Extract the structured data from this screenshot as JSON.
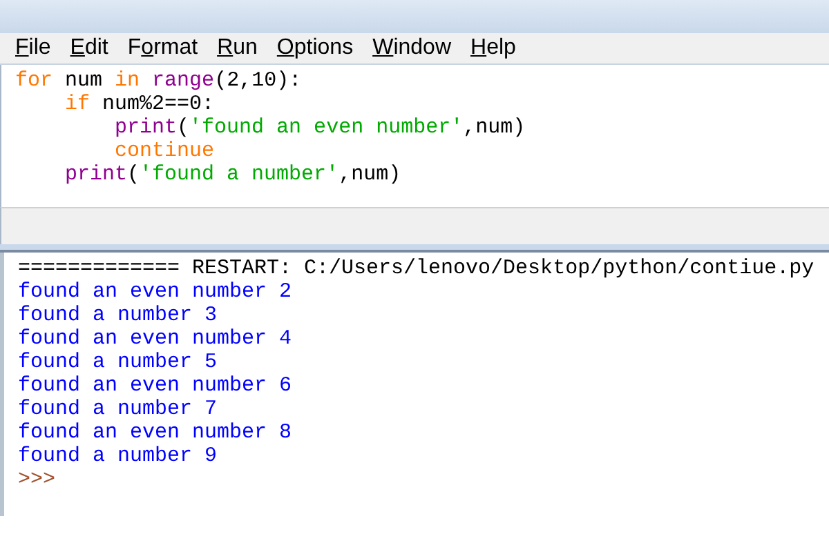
{
  "menu": [
    {
      "parts": [
        {
          "text": "F",
          "underlined": true
        },
        {
          "text": "ile",
          "underlined": false
        }
      ]
    },
    {
      "parts": [
        {
          "text": "E",
          "underlined": true
        },
        {
          "text": "dit",
          "underlined": false
        }
      ]
    },
    {
      "parts": [
        {
          "text": "F",
          "underlined": false
        },
        {
          "text": "o",
          "underlined": true
        },
        {
          "text": "rmat",
          "underlined": false
        }
      ]
    },
    {
      "parts": [
        {
          "text": "R",
          "underlined": true
        },
        {
          "text": "un",
          "underlined": false
        }
      ]
    },
    {
      "parts": [
        {
          "text": "O",
          "underlined": true
        },
        {
          "text": "ptions",
          "underlined": false
        }
      ]
    },
    {
      "parts": [
        {
          "text": "W",
          "underlined": true
        },
        {
          "text": "indow",
          "underlined": false
        }
      ]
    },
    {
      "parts": [
        {
          "text": "H",
          "underlined": true
        },
        {
          "text": "elp",
          "underlined": false
        }
      ]
    }
  ],
  "editor": {
    "lines": [
      [
        {
          "kind": "keyword",
          "text": "for"
        },
        {
          "kind": "plain",
          "text": " num "
        },
        {
          "kind": "keyword",
          "text": "in"
        },
        {
          "kind": "builtin",
          "text": " range"
        },
        {
          "kind": "plain",
          "text": "(2,10):"
        }
      ],
      [
        {
          "kind": "keyword",
          "text": "    if"
        },
        {
          "kind": "plain",
          "text": " num%2==0:"
        }
      ],
      [
        {
          "kind": "builtin",
          "text": "        print"
        },
        {
          "kind": "plain",
          "text": "("
        },
        {
          "kind": "string",
          "text": "'found an even number'"
        },
        {
          "kind": "plain",
          "text": ",num)"
        }
      ],
      [
        {
          "kind": "keyword",
          "text": "        continue"
        }
      ],
      [
        {
          "kind": "builtin",
          "text": "    print"
        },
        {
          "kind": "plain",
          "text": "("
        },
        {
          "kind": "string",
          "text": "'found a number'"
        },
        {
          "kind": "plain",
          "text": ",num)"
        }
      ]
    ]
  },
  "shell": {
    "lines": [
      {
        "kind": "restart",
        "text": "============= RESTART: C:/Users/lenovo/Desktop/python/contiue.py"
      },
      {
        "kind": "output",
        "text": "found an even number 2"
      },
      {
        "kind": "output",
        "text": "found a number 3"
      },
      {
        "kind": "output",
        "text": "found an even number 4"
      },
      {
        "kind": "output",
        "text": "found a number 5"
      },
      {
        "kind": "output",
        "text": "found an even number 6"
      },
      {
        "kind": "output",
        "text": "found a number 7"
      },
      {
        "kind": "output",
        "text": "found an even number 8"
      },
      {
        "kind": "output",
        "text": "found a number 9"
      },
      {
        "kind": "prompt",
        "text": ">>>"
      }
    ]
  }
}
